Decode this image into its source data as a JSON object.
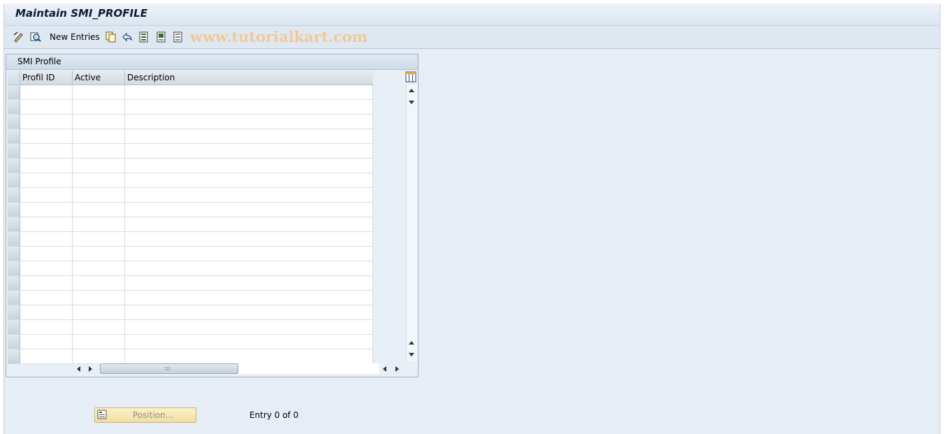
{
  "window": {
    "title": "Maintain SMI_PROFILE"
  },
  "toolbar": {
    "new_entries_label": "New Entries",
    "watermark": "www.tutorialkart.com"
  },
  "table": {
    "title": "SMI Profile",
    "columns": [
      "Profil ID",
      "Active",
      "Description"
    ],
    "row_count": 19
  },
  "footer": {
    "position_label": "Position...",
    "entry_text": "Entry 0 of 0"
  }
}
